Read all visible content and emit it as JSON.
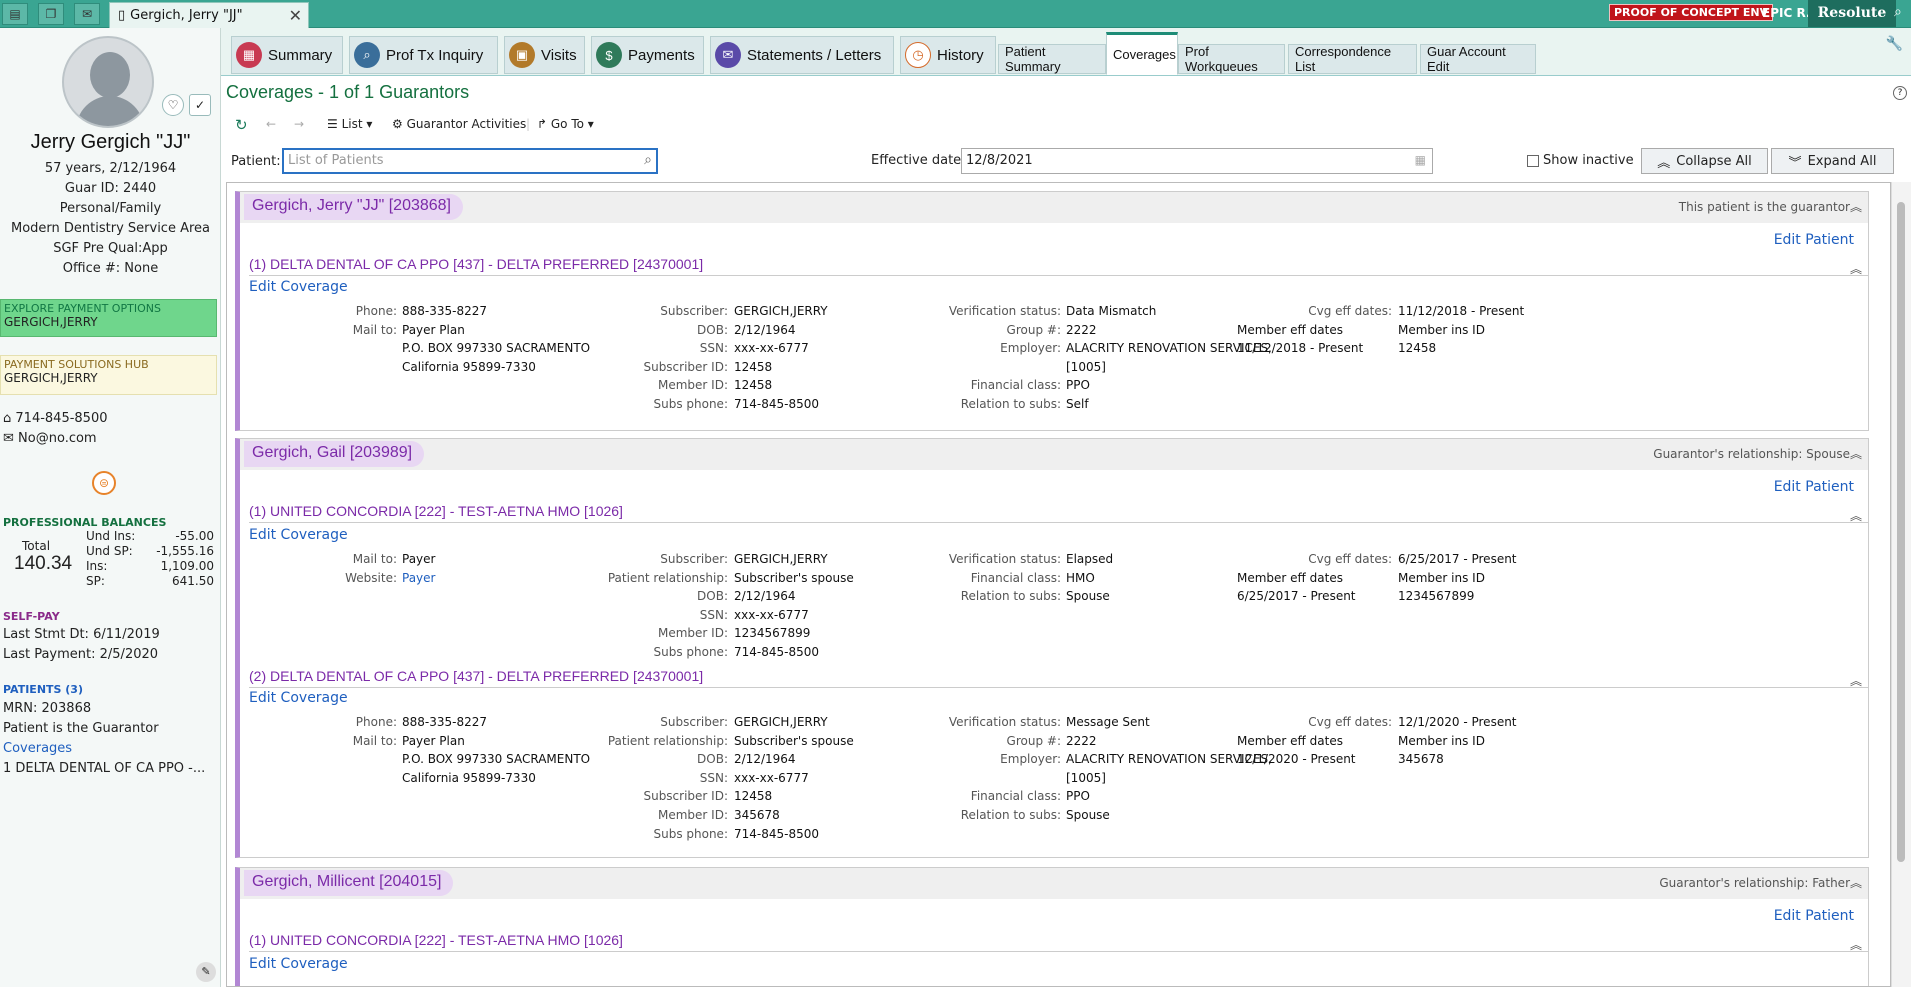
{
  "topbar": {
    "tab_title": "Gergich, Jerry \"JJ\"",
    "env_badge": "PROOF OF CONCEPT ENV",
    "user": "EPIC R.",
    "brand": "Resolute"
  },
  "patient": {
    "name": "Jerry Gergich \"JJ\"",
    "age_dob": "57 years, 2/12/1964",
    "guar_id": "Guar ID: 2440",
    "type": "Personal/Family",
    "service_area": "Modern Dentistry Service Area",
    "sgf": "SGF Pre Qual:App",
    "office": "Office #: None",
    "phone": "714-845-8500",
    "email": "No@no.com"
  },
  "explore": {
    "title": "EXPLORE PAYMENT OPTIONS",
    "name": "GERGICH,JERRY"
  },
  "hub": {
    "title": "PAYMENT SOLUTIONS HUB",
    "name": "GERGICH,JERRY"
  },
  "balances": {
    "heading": "PROFESSIONAL BALANCES",
    "total_label": "Total",
    "total": "140.34",
    "rows": [
      {
        "label": "Und Ins:",
        "value": "-55.00"
      },
      {
        "label": "Und SP:",
        "value": "-1,555.16"
      },
      {
        "label": "Ins:",
        "value": "1,109.00"
      },
      {
        "label": "SP:",
        "value": "641.50"
      }
    ]
  },
  "selfpay": {
    "heading": "SELF-PAY",
    "last_stmt": "Last Stmt Dt: 6/11/2019",
    "last_payment": "Last Payment: 2/5/2020"
  },
  "patients_box": {
    "heading": "PATIENTS (3)",
    "mrn": "MRN: 203868",
    "guar_note": "Patient is the Guarantor",
    "coverages_link": "Coverages",
    "coverage_item": "1  DELTA DENTAL OF CA PPO -..."
  },
  "nav": {
    "tabs": [
      "Summary",
      "Prof Tx Inquiry",
      "Visits",
      "Payments",
      "Statements / Letters",
      "History"
    ],
    "small_tabs": [
      "Patient Summary",
      "Coverages",
      "Prof Workqueues",
      "Correspondence List",
      "Guar Account Edit"
    ]
  },
  "main": {
    "title": "Coverages - 1 of 1 Guarantors",
    "toolbar": {
      "list": "List",
      "guar_activities": "Guarantor Activities",
      "goto": "Go To"
    },
    "patient_label": "Patient:",
    "patient_placeholder": "List of Patients",
    "effective_label": "Effective date:",
    "effective_value": "12/8/2021",
    "show_inactive": "Show inactive",
    "collapse_all": "Collapse All",
    "expand_all": "Expand All"
  },
  "sections": [
    {
      "name": "Gergich, Jerry \"JJ\" [203868]",
      "relation": "This patient is the guarantor",
      "edit_patient": "Edit Patient",
      "coverages": [
        {
          "title": "(1) DELTA DENTAL OF CA PPO [437] - DELTA PREFERRED [24370001]",
          "edit": "Edit Coverage",
          "col1": [
            [
              "Phone:",
              "888-335-8227"
            ],
            [
              "Mail to:",
              "Payer Plan"
            ],
            [
              "",
              "P.O. BOX 997330 SACRAMENTO"
            ],
            [
              "",
              "California 95899-7330"
            ]
          ],
          "col2": [
            [
              "Subscriber:",
              "GERGICH,JERRY"
            ],
            [
              "DOB:",
              "2/12/1964"
            ],
            [
              "SSN:",
              "xxx-xx-6777"
            ],
            [
              "Subscriber ID:",
              "12458"
            ],
            [
              "Member ID:",
              "12458"
            ],
            [
              "Subs phone:",
              "714-845-8500"
            ]
          ],
          "col3": [
            [
              "Verification status:",
              "Data Mismatch"
            ],
            [
              "Group #:",
              "2222"
            ],
            [
              "Employer:",
              "ALACRITY RENOVATION SERVICES,"
            ],
            [
              "",
              "[1005]"
            ],
            [
              "Financial class:",
              "PPO"
            ],
            [
              "Relation to subs:",
              "Self"
            ]
          ],
          "col4": [
            [
              "Cvg eff dates:",
              "11/12/2018 - Present"
            ],
            [
              "Member eff dates",
              "Member ins ID"
            ],
            [
              "11/12/2018 - Present",
              "12458"
            ]
          ]
        }
      ]
    },
    {
      "name": "Gergich, Gail [203989]",
      "relation": "Guarantor's relationship: Spouse",
      "edit_patient": "Edit Patient",
      "coverages": [
        {
          "title": "(1) UNITED CONCORDIA [222] - TEST-AETNA HMO [1026]",
          "edit": "Edit Coverage",
          "col1": [
            [
              "Mail to:",
              "Payer"
            ],
            [
              "Website:",
              "Payer"
            ]
          ],
          "col2": [
            [
              "Subscriber:",
              "GERGICH,JERRY"
            ],
            [
              "Patient relationship:",
              "Subscriber's spouse"
            ],
            [
              "DOB:",
              "2/12/1964"
            ],
            [
              "SSN:",
              "xxx-xx-6777"
            ],
            [
              "Member ID:",
              "1234567899"
            ],
            [
              "Subs phone:",
              "714-845-8500"
            ]
          ],
          "col3": [
            [
              "Verification status:",
              "Elapsed"
            ],
            [
              "Financial class:",
              "HMO"
            ],
            [
              "Relation to subs:",
              "Spouse"
            ]
          ],
          "col4": [
            [
              "Cvg eff dates:",
              "6/25/2017 - Present"
            ],
            [
              "Member eff dates",
              "Member ins ID"
            ],
            [
              "6/25/2017 - Present",
              "1234567899"
            ]
          ]
        },
        {
          "title": "(2) DELTA DENTAL OF CA PPO [437] - DELTA PREFERRED [24370001]",
          "edit": "Edit Coverage",
          "col1": [
            [
              "Phone:",
              "888-335-8227"
            ],
            [
              "Mail to:",
              "Payer Plan"
            ],
            [
              "",
              "P.O. BOX 997330 SACRAMENTO"
            ],
            [
              "",
              "California 95899-7330"
            ]
          ],
          "col2": [
            [
              "Subscriber:",
              "GERGICH,JERRY"
            ],
            [
              "Patient relationship:",
              "Subscriber's spouse"
            ],
            [
              "DOB:",
              "2/12/1964"
            ],
            [
              "SSN:",
              "xxx-xx-6777"
            ],
            [
              "Subscriber ID:",
              "12458"
            ],
            [
              "Member ID:",
              "345678"
            ],
            [
              "Subs phone:",
              "714-845-8500"
            ]
          ],
          "col3": [
            [
              "Verification status:",
              "Message Sent"
            ],
            [
              "Group #:",
              "2222"
            ],
            [
              "Employer:",
              "ALACRITY RENOVATION SERVICES,"
            ],
            [
              "",
              "[1005]"
            ],
            [
              "Financial class:",
              "PPO"
            ],
            [
              "Relation to subs:",
              "Spouse"
            ]
          ],
          "col4": [
            [
              "Cvg eff dates:",
              "12/1/2020 - Present"
            ],
            [
              "Member eff dates",
              "Member ins ID"
            ],
            [
              "12/1/2020 - Present",
              "345678"
            ]
          ]
        }
      ]
    },
    {
      "name": "Gergich, Millicent [204015]",
      "relation": "Guarantor's relationship: Father",
      "edit_patient": "Edit Patient",
      "coverages": [
        {
          "title": "(1) UNITED CONCORDIA [222] - TEST-AETNA HMO [1026]",
          "edit": "Edit Coverage"
        }
      ]
    }
  ]
}
